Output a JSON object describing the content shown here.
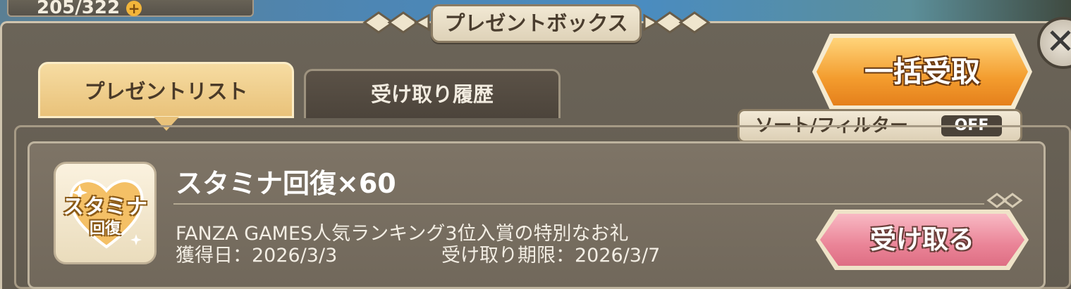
{
  "stamina_counter": "205/322",
  "title": "プレゼントボックス",
  "tabs": [
    {
      "label": "プレゼントリスト",
      "active": true
    },
    {
      "label": "受け取り履歴",
      "active": false
    }
  ],
  "bulk_receive_label": "一括受取",
  "sort_filter": {
    "label": "ソート/フィルター",
    "state": "OFF"
  },
  "items": [
    {
      "icon_text_top": "スタミナ",
      "icon_text_bottom": "回復",
      "name": "スタミナ回復×60",
      "description": "FANZA GAMES人気ランキング3位入賞の特別なお礼",
      "acquired": "獲得日：2026/3/3",
      "deadline": "受け取り期限：2026/3/7",
      "receive_label": "受け取る"
    }
  ],
  "colors": {
    "accent_orange": "#f39c2e",
    "receive_pink": "#ea8497",
    "panel_brown": "#6b6458",
    "tab_gold": "#e9c27a"
  }
}
